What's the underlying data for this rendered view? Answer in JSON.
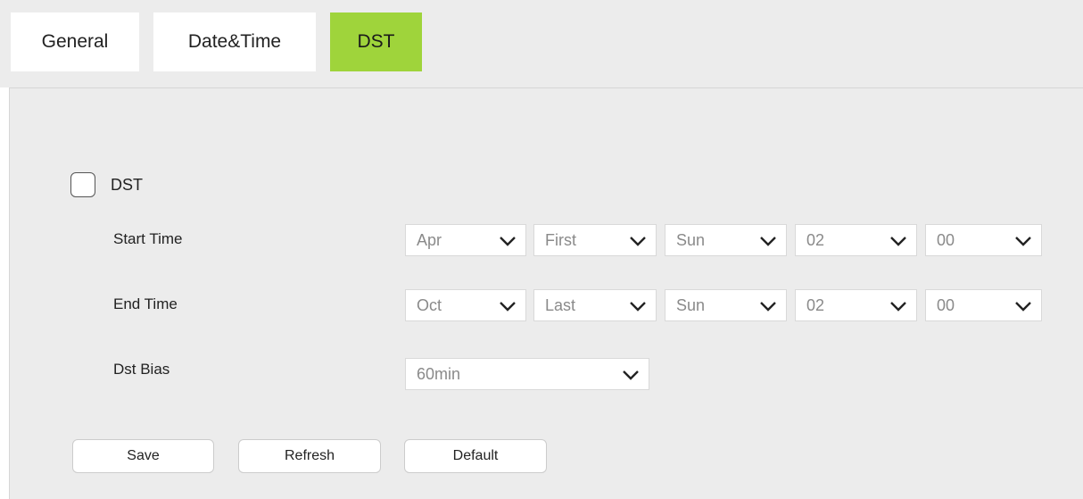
{
  "tabs": [
    {
      "label": "General",
      "active": false
    },
    {
      "label": "Date&Time",
      "active": false
    },
    {
      "label": "DST",
      "active": true
    }
  ],
  "dst_checkbox": {
    "label": "DST",
    "checked": false
  },
  "start_time": {
    "label": "Start Time",
    "month": "Apr",
    "week": "First",
    "day": "Sun",
    "hour": "02",
    "minute": "00"
  },
  "end_time": {
    "label": "End Time",
    "month": "Oct",
    "week": "Last",
    "day": "Sun",
    "hour": "02",
    "minute": "00"
  },
  "dst_bias": {
    "label": "Dst Bias",
    "value": "60min"
  },
  "buttons": {
    "save": "Save",
    "refresh": "Refresh",
    "default": "Default"
  },
  "colors": {
    "active_tab": "#9fd43b",
    "panel_bg": "#ececec"
  },
  "icons": {
    "select_arrow": "chevron-down-icon"
  }
}
